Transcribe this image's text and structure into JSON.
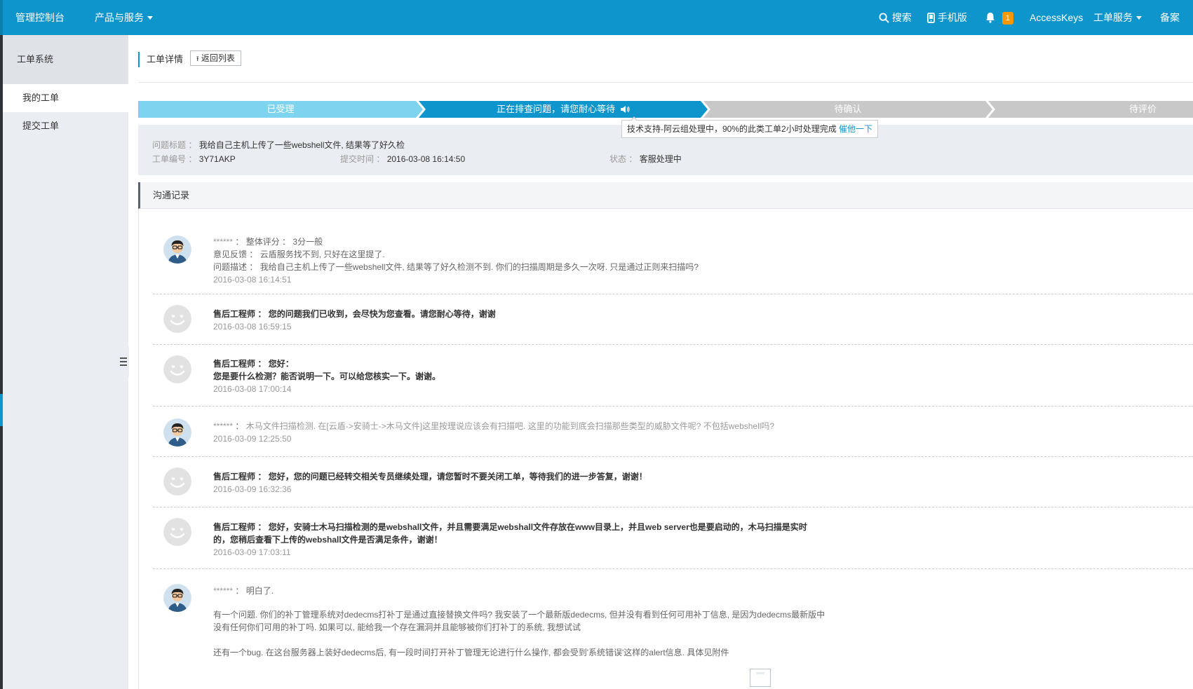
{
  "topbar": {
    "console": "管理控制台",
    "products": "产品与服务",
    "search": "搜索",
    "mobile": "手机版",
    "notifications_count": "1",
    "accesskeys": "AccessKeys",
    "ticket_service": "工单服务",
    "beian": "备案"
  },
  "sidebar": {
    "title": "工单系统",
    "items": [
      {
        "label": "我的工单",
        "active": true
      },
      {
        "label": "提交工单",
        "active": false
      }
    ]
  },
  "page": {
    "title": "工单详情",
    "back_button": "返回列表"
  },
  "steps": [
    {
      "label": "已受理",
      "state": "done"
    },
    {
      "label": "正在排查问题，请您耐心等待",
      "state": "current"
    },
    {
      "label": "待确认",
      "state": "pending"
    },
    {
      "label": "待评价",
      "state": "pending"
    }
  ],
  "tooltip": {
    "text": "技术支持-阿云组处理中，90%的此类工单2小时处理完成",
    "link": "催他一下"
  },
  "ticket": {
    "subject_label": "问题标题",
    "subject": "我给自己主机上传了一些webshell文件, 结果等了好久检",
    "id_label": "工单编号",
    "id": "3Y71AKP",
    "submitted_label": "提交时间",
    "submitted": "2016-03-08 16:14:50",
    "status_label": "状态",
    "status": "客服处理中"
  },
  "section": {
    "title": "沟通记录"
  },
  "messages": [
    {
      "author": "******",
      "rating_label": "整体评分",
      "rating": "3分一般",
      "feedback_label": "意见反馈",
      "feedback": "云盾服务找不到, 只好在这里提了.",
      "desc_label": "问题描述",
      "desc": "我给自己主机上传了一些webshell文件, 结果等了好久检测不到. 你们的扫描周期是多久一次呀. 只是通过正则来扫描吗?",
      "time": "2016-03-08 16:14:51"
    },
    {
      "author": "售后工程师",
      "lines": [
        "您的问题我们已收到，会尽快为您查看。请您耐心等待，谢谢"
      ],
      "time": "2016-03-08 16:59:15"
    },
    {
      "author": "售后工程师",
      "lines": [
        "您好：",
        "您是要什么检测？能否说明一下。可以给您核实一下。谢谢。"
      ],
      "time": "2016-03-08 17:00:14"
    },
    {
      "author": "******",
      "lines": [
        "木马文件扫描检测. 在[云盾->安骑士->木马文件]这里按理说应该会有扫描吧. 这里的功能到底会扫描那些类型的威胁文件呢? 不包括webshell吗?"
      ],
      "time": "2016-03-09 12:25:50"
    },
    {
      "author": "售后工程师",
      "lines": [
        "您好，您的问题已经转交相关专员继续处理，请您暂时不要关闭工单，等待我们的进一步答复，谢谢！"
      ],
      "time": "2016-03-09 16:32:36"
    },
    {
      "author": "售后工程师",
      "lines": [
        "您好，安骑士木马扫描检测的是webshall文件，并且需要满足webshall文件存放在www目录上，并且web server也是要启动的，木马扫描是实时",
        "的，您稍后查看下上传的webshall文件是否满足条件，谢谢！"
      ],
      "time": "2016-03-09 17:03:11"
    },
    {
      "author": "******",
      "lines": [
        "明白了.",
        "有一个问题. 你们的补丁管理系统对dedecms打补丁是通过直接替换文件吗? 我安装了一个最新版dedecms, 但并没有看到任何可用补丁信息, 是因为dedecms最新版中",
        "没有任何你们可用的补丁吗. 如果可以, 能给我一个存在漏洞并且能够被你们打补丁的系统, 我想试试",
        "还有一个bug. 在这台服务器上装好dedecms后, 有一段时间打开补丁管理无论进行什么操作, 都会受到'系统错误'这样的alert信息. 具体见附件"
      ]
    }
  ],
  "colors": {
    "topbar": "#0e96cc",
    "step_done": "#7ed3ef",
    "step_current": "#0e96cc",
    "step_pending": "#c8c8c8",
    "link": "#0e96cc",
    "badge": "#f39800"
  }
}
